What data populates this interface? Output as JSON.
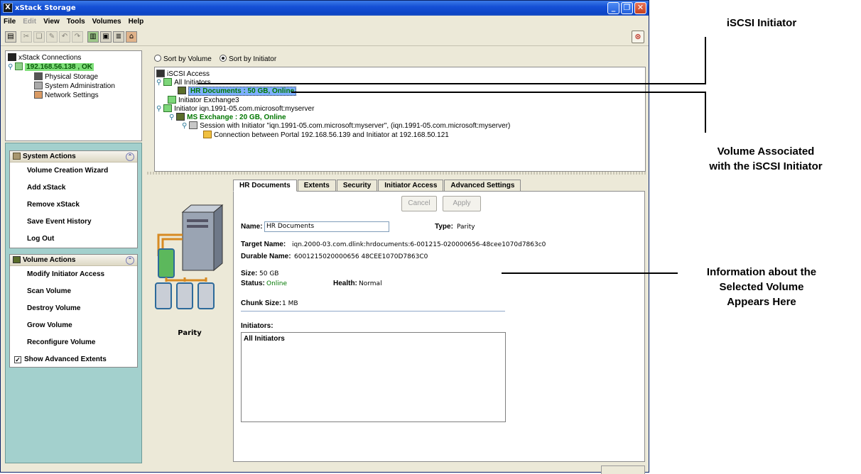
{
  "window": {
    "title": "xStack Storage",
    "app_icon_glyph": "X"
  },
  "menu": [
    "File",
    "Edit",
    "View",
    "Tools",
    "Volumes",
    "Help"
  ],
  "connections": {
    "root_label": "xStack Connections",
    "host_label": "192.168.56.138 , OK",
    "items": [
      "Physical Storage",
      "System Administration",
      "Network Settings"
    ]
  },
  "system_actions": {
    "title": "System Actions",
    "items": [
      "Volume Creation Wizard",
      "Add xStack",
      "Remove xStack",
      "Save Event History",
      "Log Out"
    ]
  },
  "volume_actions": {
    "title": "Volume Actions",
    "items": [
      "Modify Initiator Access",
      "Scan Volume",
      "Destroy Volume",
      "Grow Volume",
      "Reconfigure Volume"
    ],
    "checkbox_label": "Show Advanced Extents",
    "checkbox_checked": true
  },
  "sort": {
    "by_volume": "Sort by Volume",
    "by_initiator": "Sort by Initiator",
    "selected": "by_initiator"
  },
  "iscsi_tree": {
    "root": "iSCSI Access",
    "all_initiators": "All Initiators",
    "hr_documents": "HR Documents : 50 GB, Online",
    "initiator_exchange": "Initiator Exchange3",
    "initiator_iqn": "Initiator iqn.1991-05.com.microsoft:myserver",
    "ms_exchange": "MS Exchange : 20 GB, Online",
    "session": "Session with Initiator \"iqn.1991-05.com.microsoft:myserver\", (iqn.1991-05.com.microsoft:myserver)",
    "connection": "Connection between Portal 192.168.56.139 and Initiator at  192.168.50.121"
  },
  "tabs": [
    "HR Documents",
    "Extents",
    "Security",
    "Initiator Access",
    "Advanced Settings"
  ],
  "active_tab": "HR Documents",
  "raid_label": "Parity",
  "buttons": {
    "cancel": "Cancel",
    "apply": "Apply"
  },
  "details": {
    "name_label": "Name:",
    "name_value": "HR Documents",
    "type_label": "Type:",
    "type_value": "Parity",
    "target_name_label": "Target Name:",
    "target_name_value": "iqn.2000-03.com.dlink:hrdocuments:6-001215-020000656-48cee1070d7863c0",
    "durable_name_label": "Durable Name:",
    "durable_name_value": "6001215020000656 48CEE1070D7863C0",
    "size_label": "Size:",
    "size_value": "50 GB",
    "status_label": "Status:",
    "status_value": "Online",
    "health_label": "Health:",
    "health_value": "Normal",
    "chunk_label": "Chunk Size:",
    "chunk_value": "1 MB",
    "initiators_label": "Initiators:",
    "initiators_list": [
      "All Initiators"
    ]
  },
  "callouts": {
    "iscsi_initiator": "iSCSI Initiator",
    "volume_associated_line1": "Volume Associated",
    "volume_associated_line2": "with the iSCSI Initiator",
    "info_line1": "Information about the",
    "info_line2": "Selected Volume",
    "info_line3": "Appears Here"
  },
  "colors": {
    "titlebar": "#0d45c6",
    "left_panel": "#a3d0cd",
    "online_green": "#007700",
    "selection": "#7fb0ff"
  }
}
